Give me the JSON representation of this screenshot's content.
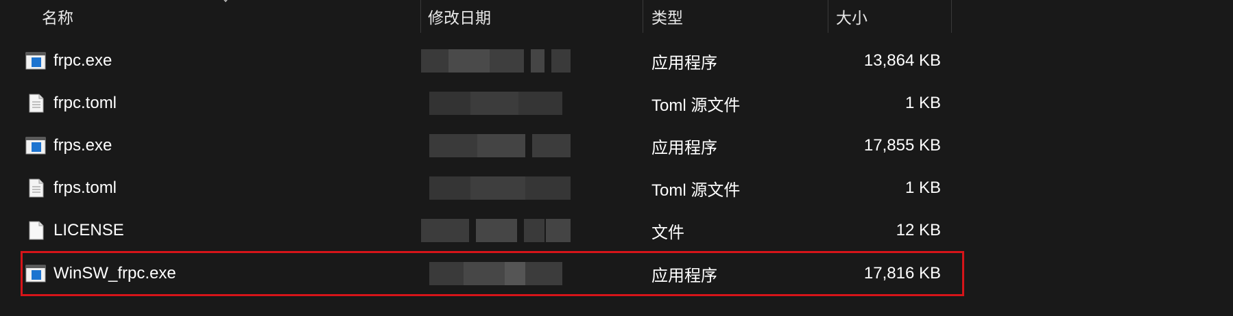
{
  "columns": {
    "name": "名称",
    "modified": "修改日期",
    "type": "类型",
    "size": "大小"
  },
  "files": [
    {
      "name": "frpc.exe",
      "type": "应用程序",
      "size": "13,864 KB",
      "icon": "exe-icon"
    },
    {
      "name": "frpc.toml",
      "type": "Toml 源文件",
      "size": "1 KB",
      "icon": "text-file-icon"
    },
    {
      "name": "frps.exe",
      "type": "应用程序",
      "size": "17,855 KB",
      "icon": "exe-icon"
    },
    {
      "name": "frps.toml",
      "type": "Toml 源文件",
      "size": "1 KB",
      "icon": "text-file-icon"
    },
    {
      "name": "LICENSE",
      "type": "文件",
      "size": "12 KB",
      "icon": "blank-file-icon"
    },
    {
      "name": "WinSW_frpc.exe",
      "type": "应用程序",
      "size": "17,816 KB",
      "icon": "exe-icon"
    }
  ],
  "highlight_color": "#d61419"
}
